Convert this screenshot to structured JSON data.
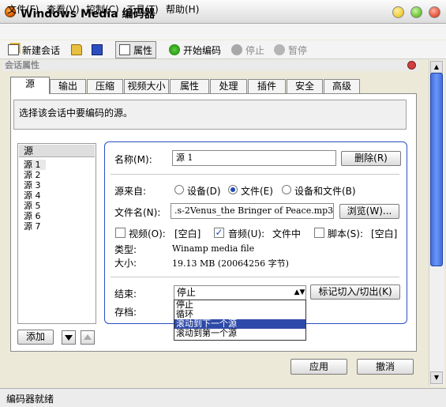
{
  "window": {
    "title": "Windows Media 编码器"
  },
  "menu": [
    "文件(F)",
    "查看(V)",
    "控制(C)",
    "工具(T)",
    "帮助(H)"
  ],
  "toolbar": {
    "new_session": "新建会话",
    "properties": "属性",
    "start_encoding": "开始编码",
    "stop": "停止",
    "pause": "暂停"
  },
  "panel": {
    "title": "会话属性"
  },
  "tabs": [
    "源",
    "输出",
    "压缩",
    "视频大小",
    "属性",
    "处理",
    "插件",
    "安全",
    "高级"
  ],
  "description": "选择该会话中要编码的源。",
  "source_list": {
    "header": "源",
    "items": [
      "源 1",
      "源 2",
      "源 3",
      "源 4",
      "源 5",
      "源 6",
      "源 7"
    ]
  },
  "buttons": {
    "add": "添加",
    "apply": "应用",
    "cancel": "撤消"
  },
  "detail": {
    "name_label": "名称(M):",
    "name_value": "源 1",
    "delete_btn": "删除(R)",
    "source_from_label": "源来自:",
    "device": "设备(D)",
    "file": "文件(E)",
    "device_and_file": "设备和文件(B)",
    "source_from_selected": "文件(E)",
    "filename_label": "文件名(N):",
    "filename_value": ".s-2Venus_the Bringer of Peace.mp3",
    "browse_btn": "浏览(W)...",
    "video_label": "视频(O):",
    "video_value": "[空白]",
    "video_checked": false,
    "audio_label": "音频(U):",
    "audio_value": "文件中",
    "audio_checked": true,
    "script_label": "脚本(S):",
    "script_value": "[空白]",
    "script_checked": false,
    "type_label": "类型:",
    "type_value": "Winamp media file",
    "size_label": "大小:",
    "size_value": "19.13 MB (20064256 字节)",
    "end_label": "结束:",
    "end_value": "停止",
    "mark_btn": "标记切入/切出(K)",
    "archive_label": "存档:",
    "end_options": [
      "停止",
      "循环",
      "滚动到下一个源",
      "滚动到第一个源"
    ],
    "end_highlighted": "滚动到下一个源"
  },
  "status": "编码器就绪"
}
